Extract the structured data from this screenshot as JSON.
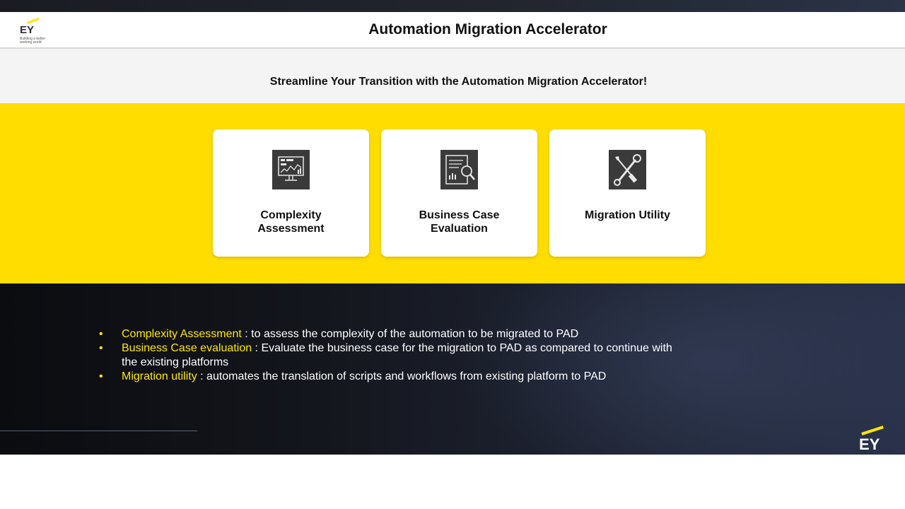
{
  "header": {
    "logo_text": "EY",
    "logo_tagline": "Building a better working world",
    "title": "Automation Migration Accelerator"
  },
  "subtitle": "Streamline Your Transition with the Automation Migration Accelerator!",
  "cards": [
    {
      "label_line1": "Complexity",
      "label_line2": "Assessment",
      "icon": "dashboard-monitor-icon"
    },
    {
      "label_line1": "Business Case",
      "label_line2": "Evaluation",
      "icon": "document-magnifier-icon"
    },
    {
      "label_line1": "Migration Utility",
      "label_line2": "",
      "icon": "tools-wrench-screwdriver-icon"
    }
  ],
  "bullets": [
    {
      "highlight": "Complexity Assessment",
      "text": " : to assess the complexity of the automation to be migrated to PAD"
    },
    {
      "highlight": "Business Case evaluation",
      "text": " : Evaluate the business case for the migration to PAD as compared to continue with the existing platforms"
    },
    {
      "highlight": "Migration utility",
      "text": " : automates the translation of scripts and workflows from existing platform to PAD"
    }
  ],
  "footer_logo_text": "EY",
  "colors": {
    "accent_yellow": "#ffe600",
    "card_band": "#ffdd00",
    "icon_bg": "#3a3a3a"
  }
}
